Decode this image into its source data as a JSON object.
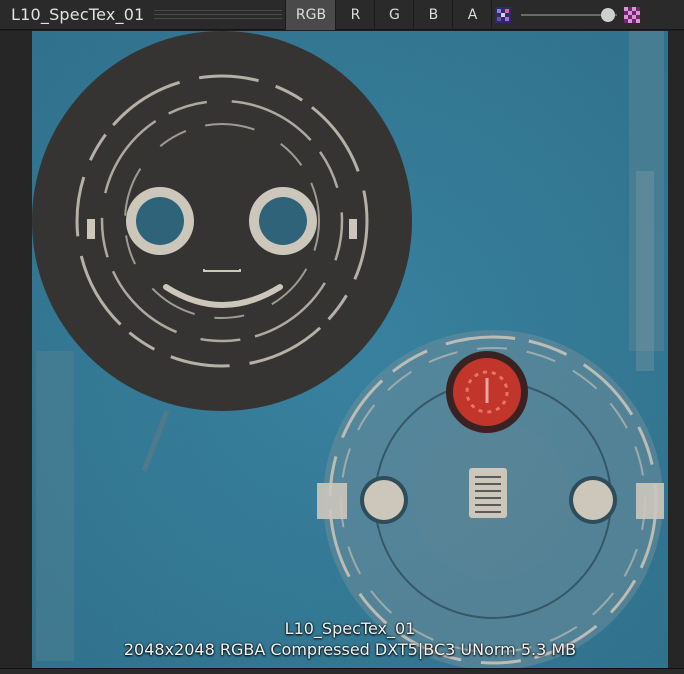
{
  "toolbar": {
    "texture_name": "L10_SpecTex_01",
    "channels": [
      "RGB",
      "R",
      "G",
      "B",
      "A"
    ],
    "active_channel": "RGB",
    "left_icon": "checker-color-icon",
    "right_icon": "checker-alpha-icon",
    "slider_value": 1.0
  },
  "caption": {
    "name": "L10_SpecTex_01",
    "info": "2048x2048  RGBA Compressed DXT5|BC3 UNorm   5.3 MB"
  },
  "colors": {
    "texture_bg": "#2f7491",
    "face_disk": "#353432",
    "paint": "#cdc7bb",
    "red_lamp": "#c2352a"
  }
}
